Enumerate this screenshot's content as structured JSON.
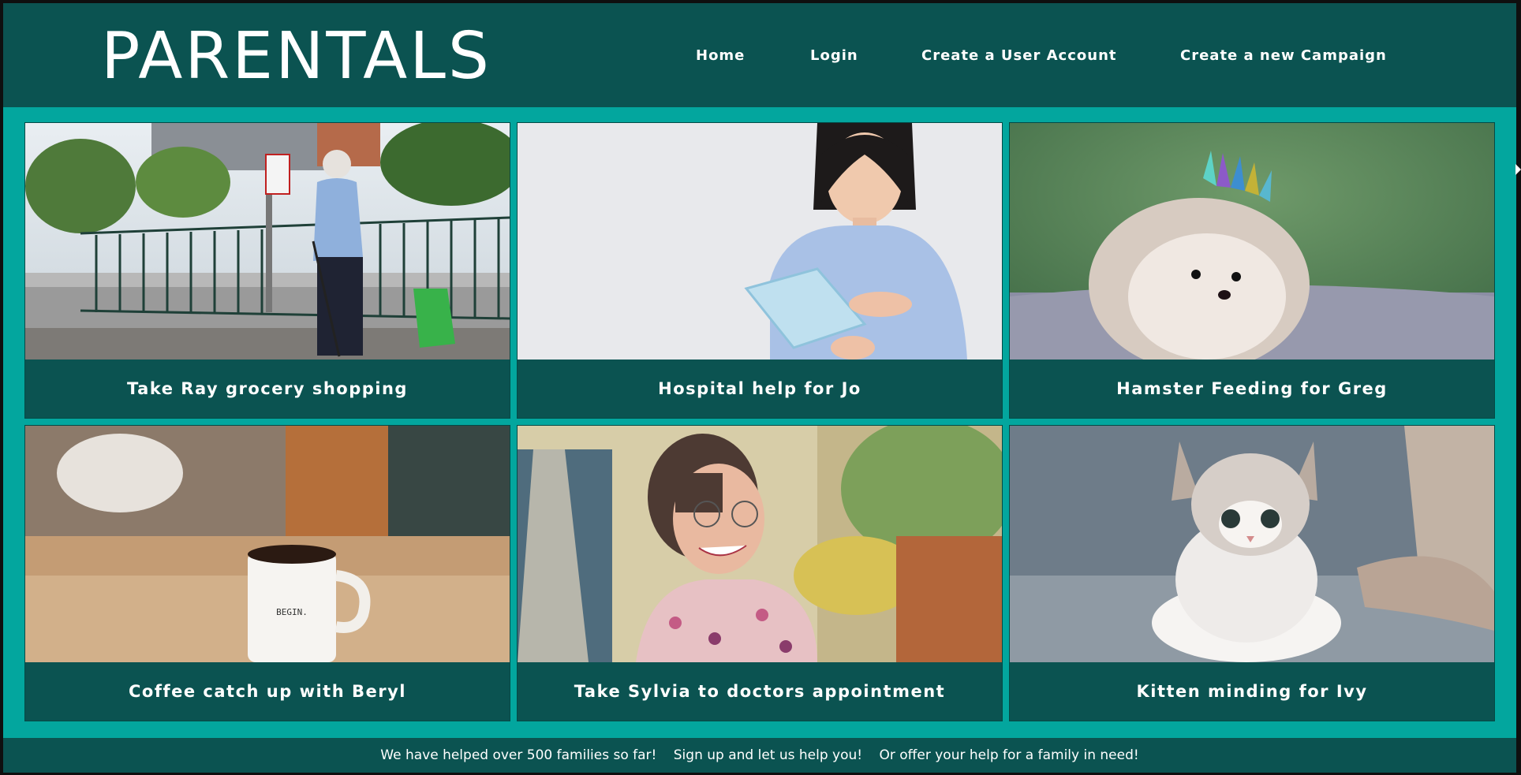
{
  "brand": {
    "logo": "PARENTALS"
  },
  "nav": {
    "home": "Home",
    "login": "Login",
    "create_account": "Create a User Account",
    "create_campaign": "Create a new Campaign"
  },
  "campaigns": [
    {
      "title": "Take Ray grocery shopping",
      "image": "elderly-man-shopping-photo"
    },
    {
      "title": "Hospital help for Jo",
      "image": "woman-arm-sling-photo"
    },
    {
      "title": "Hamster Feeding for Greg",
      "image": "hedgehog-crown-photo"
    },
    {
      "title": "Coffee catch up with Beryl",
      "image": "coffee-mug-photo"
    },
    {
      "title": "Take Sylvia to doctors appointment",
      "image": "smiling-elderly-woman-photo"
    },
    {
      "title": "Kitten minding for Ivy",
      "image": "kitten-photo"
    }
  ],
  "footer": {
    "line1": "We have helped over 500 families so far!",
    "line2": "Sign up and let us help you!",
    "line3": "Or offer your help for a family in need!"
  },
  "colors": {
    "header": "#0b5351",
    "accent": "#03a69e",
    "text": "#ffffff"
  }
}
